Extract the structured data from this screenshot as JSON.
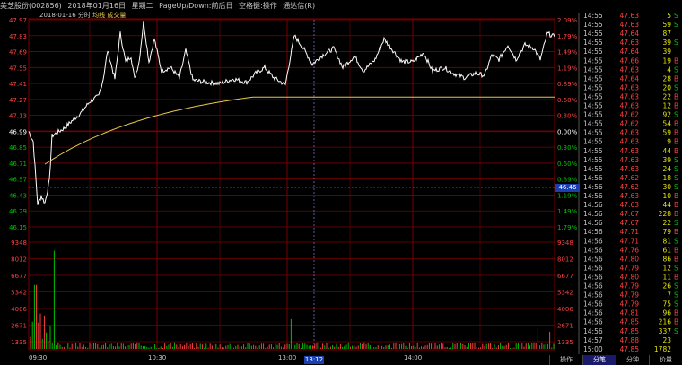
{
  "header": {
    "stock_name": "美芝股份(002856)",
    "date_text": "2018年01月16日",
    "weekday": "星期二",
    "hint": "PageUp/Down:前后日",
    "hotkey": "空格键:操作",
    "app": "通达信(R)"
  },
  "legend": {
    "date_label": "2018-01-16 分时",
    "avg_label": "均线",
    "vol_label": "成交量"
  },
  "price_axis": {
    "left": [
      "47.97",
      "47.83",
      "47.69",
      "47.55",
      "47.41",
      "47.27",
      "47.13",
      "46.99",
      "46.85",
      "46.71",
      "46.57",
      "46.43",
      "46.29",
      "46.15"
    ],
    "right": [
      "2.09%",
      "1.79%",
      "1.49%",
      "1.19%",
      "0.89%",
      "0.60%",
      "0.30%",
      "0.00%",
      "0.30%",
      "0.60%",
      "0.89%",
      "1.19%",
      "1.49%",
      "1.79%"
    ]
  },
  "volume_axis": [
    "9348",
    "8012",
    "6677",
    "5342",
    "4006",
    "2671",
    "1335"
  ],
  "time_axis": [
    "09:30",
    "10:30",
    "13:00",
    "14:00"
  ],
  "crosshair": {
    "price": "46.46",
    "time": "13:12"
  },
  "colors": {
    "price_line": "#ffffff",
    "avg_line": "#e6c84a",
    "grid": "#7a0000",
    "up": "#ff4040",
    "down": "#00c000",
    "flat": "#ffffff",
    "buy": "#ff4040",
    "sell": "#00c000",
    "volume": "#ffff00"
  },
  "ticks": [
    {
      "time": "14:55",
      "price": "47.63",
      "vol": "5",
      "side": "S"
    },
    {
      "time": "14:55",
      "price": "47.63",
      "vol": "59",
      "side": "S"
    },
    {
      "time": "14:55",
      "price": "47.64",
      "vol": "87",
      "side": ""
    },
    {
      "time": "14:55",
      "price": "47.63",
      "vol": "39",
      "side": "S"
    },
    {
      "time": "14:55",
      "price": "47.64",
      "vol": "39",
      "side": ""
    },
    {
      "time": "14:55",
      "price": "47.66",
      "vol": "19",
      "side": "B"
    },
    {
      "time": "14:55",
      "price": "47.63",
      "vol": "4",
      "side": "S"
    },
    {
      "time": "14:55",
      "price": "47.64",
      "vol": "28",
      "side": "B"
    },
    {
      "time": "14:55",
      "price": "47.63",
      "vol": "20",
      "side": "S"
    },
    {
      "time": "14:55",
      "price": "47.63",
      "vol": "22",
      "side": "B"
    },
    {
      "time": "14:55",
      "price": "47.63",
      "vol": "12",
      "side": "B"
    },
    {
      "time": "14:55",
      "price": "47.62",
      "vol": "92",
      "side": "S"
    },
    {
      "time": "14:55",
      "price": "47.62",
      "vol": "54",
      "side": "B"
    },
    {
      "time": "14:55",
      "price": "47.63",
      "vol": "59",
      "side": "B"
    },
    {
      "time": "14:55",
      "price": "47.63",
      "vol": "9",
      "side": "B"
    },
    {
      "time": "14:55",
      "price": "47.63",
      "vol": "44",
      "side": "B"
    },
    {
      "time": "14:55",
      "price": "47.63",
      "vol": "39",
      "side": "S"
    },
    {
      "time": "14:55",
      "price": "47.63",
      "vol": "24",
      "side": "S"
    },
    {
      "time": "14:56",
      "price": "47.62",
      "vol": "18",
      "side": "S"
    },
    {
      "time": "14:56",
      "price": "47.62",
      "vol": "30",
      "side": "S"
    },
    {
      "time": "14:56",
      "price": "47.63",
      "vol": "10",
      "side": "B"
    },
    {
      "time": "14:56",
      "price": "47.63",
      "vol": "44",
      "side": "B"
    },
    {
      "time": "14:56",
      "price": "47.67",
      "vol": "228",
      "side": "B"
    },
    {
      "time": "14:56",
      "price": "47.67",
      "vol": "22",
      "side": "S"
    },
    {
      "time": "14:56",
      "price": "47.71",
      "vol": "79",
      "side": "B"
    },
    {
      "time": "14:56",
      "price": "47.71",
      "vol": "81",
      "side": "S"
    },
    {
      "time": "14:56",
      "price": "47.76",
      "vol": "61",
      "side": "B"
    },
    {
      "time": "14:56",
      "price": "47.80",
      "vol": "86",
      "side": "B"
    },
    {
      "time": "14:56",
      "price": "47.79",
      "vol": "12",
      "side": "S"
    },
    {
      "time": "14:56",
      "price": "47.80",
      "vol": "11",
      "side": "B"
    },
    {
      "time": "14:56",
      "price": "47.79",
      "vol": "26",
      "side": "S"
    },
    {
      "time": "14:56",
      "price": "47.79",
      "vol": "7",
      "side": "S"
    },
    {
      "time": "14:56",
      "price": "47.79",
      "vol": "75",
      "side": "S"
    },
    {
      "time": "14:56",
      "price": "47.81",
      "vol": "96",
      "side": "B"
    },
    {
      "time": "14:56",
      "price": "47.85",
      "vol": "216",
      "side": "B"
    },
    {
      "time": "14:56",
      "price": "47.85",
      "vol": "337",
      "side": "S"
    },
    {
      "time": "14:57",
      "price": "47.88",
      "vol": "23",
      "side": ""
    },
    {
      "time": "15:00",
      "price": "47.85",
      "vol": "1782",
      "side": ""
    }
  ],
  "tabs": [
    "操作",
    "分笔",
    "分钟",
    "价量"
  ],
  "prev_close": 46.99
}
